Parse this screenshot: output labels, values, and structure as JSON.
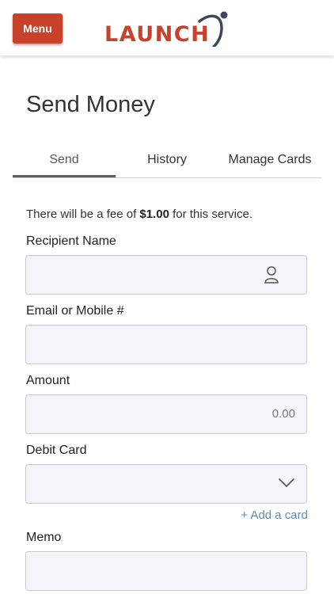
{
  "header": {
    "menu_label": "Menu",
    "logo_text": "LAUNCH"
  },
  "page": {
    "title": "Send Money"
  },
  "tabs": [
    {
      "label": "Send",
      "active": true
    },
    {
      "label": "History",
      "active": false
    },
    {
      "label": "Manage Cards",
      "active": false
    }
  ],
  "fee": {
    "prefix": "There will be a fee of ",
    "amount": "$1.00",
    "suffix": " for this service."
  },
  "form": {
    "recipient": {
      "label": "Recipient Name",
      "value": "",
      "icon": "person-icon"
    },
    "email": {
      "label": "Email or Mobile #",
      "value": ""
    },
    "amount": {
      "label": "Amount",
      "placeholder": "0.00"
    },
    "debit_card": {
      "label": "Debit Card",
      "value": "",
      "icon": "chevron-down-icon"
    },
    "add_card_label": "+ Add a card",
    "memo": {
      "label": "Memo",
      "value": ""
    }
  },
  "colors": {
    "brand": "#c8412a",
    "field_bg": "#f4f5fb",
    "link": "#5a8fb0"
  }
}
